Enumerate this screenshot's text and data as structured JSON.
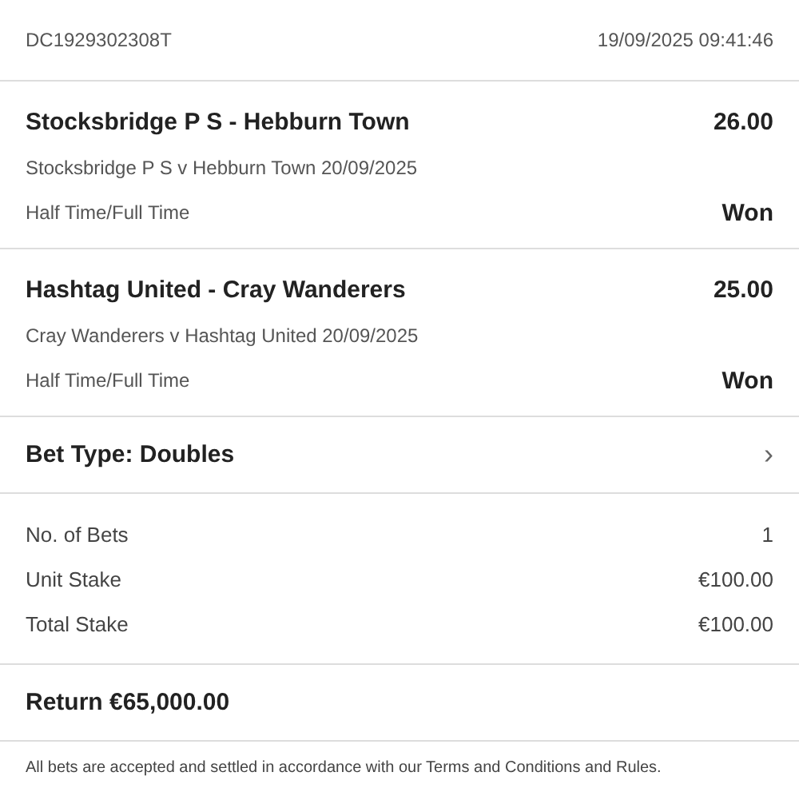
{
  "header": {
    "reference": "DC1929302308T",
    "timestamp": "19/09/2025 09:41:46"
  },
  "selections": [
    {
      "title": "Stocksbridge P S - Hebburn Town",
      "odds": "26.00",
      "event": "Stocksbridge P S v Hebburn Town 20/09/2025",
      "market": "Half Time/Full Time",
      "result": "Won"
    },
    {
      "title": "Hashtag United - Cray Wanderers",
      "odds": "25.00",
      "event": "Cray Wanderers v Hashtag United 20/09/2025",
      "market": "Half Time/Full Time",
      "result": "Won"
    }
  ],
  "bet_type": {
    "label": "Bet Type: Doubles",
    "chevron": "›"
  },
  "summary": [
    {
      "label": "No. of Bets",
      "value": "1"
    },
    {
      "label": "Unit Stake",
      "value": "€100.00"
    },
    {
      "label": "Total Stake",
      "value": "€100.00"
    }
  ],
  "return": "Return €65,000.00",
  "footer": "All bets are accepted and settled in accordance with our Terms and Conditions and Rules."
}
